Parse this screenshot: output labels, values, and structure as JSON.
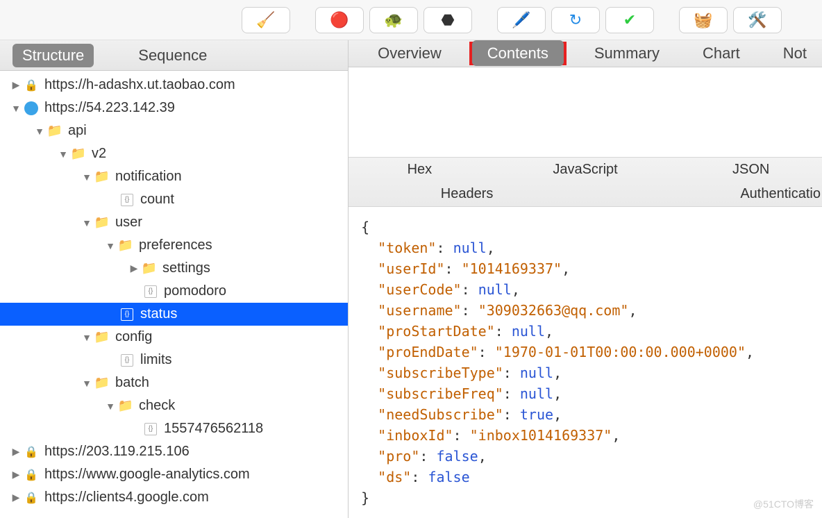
{
  "toolbar": {
    "icons": [
      "🧹",
      "🔴",
      "🐢",
      "⬣",
      "🖊️",
      "↻",
      "✔",
      "🧺",
      "🛠️"
    ]
  },
  "leftTabs": {
    "structure": "Structure",
    "sequence": "Sequence"
  },
  "tree": {
    "host1": "https://h-adashx.ut.taobao.com",
    "host2": "https://54.223.142.39",
    "api": "api",
    "v2": "v2",
    "notification": "notification",
    "count": "count",
    "user": "user",
    "preferences": "preferences",
    "settings": "settings",
    "pomodoro": "pomodoro",
    "status": "status",
    "config": "config",
    "limits": "limits",
    "batch": "batch",
    "check": "check",
    "ts": "1557476562118",
    "host3": "https://203.119.215.106",
    "host4": "https://www.google-analytics.com",
    "host5": "https://clients4.google.com"
  },
  "rightTabs": {
    "overview": "Overview",
    "contents": "Contents",
    "summary": "Summary",
    "chart": "Chart",
    "notes": "Not"
  },
  "subTabs": {
    "hex": "Hex",
    "javascript": "JavaScript",
    "json": "JSON",
    "headers": "Headers",
    "authentication": "Authenticatio"
  },
  "json": {
    "k_token": "\"token\"",
    "v_token": "null",
    "k_userId": "\"userId\"",
    "v_userId": "\"1014169337\"",
    "k_userCode": "\"userCode\"",
    "v_userCode": "null",
    "k_username": "\"username\"",
    "v_username": "\"309032663@qq.com\"",
    "k_proStartDate": "\"proStartDate\"",
    "v_proStartDate": "null",
    "k_proEndDate": "\"proEndDate\"",
    "v_proEndDate": "\"1970-01-01T00:00:00.000+0000\"",
    "k_subscribeType": "\"subscribeType\"",
    "v_subscribeType": "null",
    "k_subscribeFreq": "\"subscribeFreq\"",
    "v_subscribeFreq": "null",
    "k_needSubscribe": "\"needSubscribe\"",
    "v_needSubscribe": "true",
    "k_inboxId": "\"inboxId\"",
    "v_inboxId": "\"inbox1014169337\"",
    "k_pro": "\"pro\"",
    "v_pro": "false",
    "k_ds": "\"ds\"",
    "v_ds": "false"
  },
  "watermark": "@51CTO博客"
}
